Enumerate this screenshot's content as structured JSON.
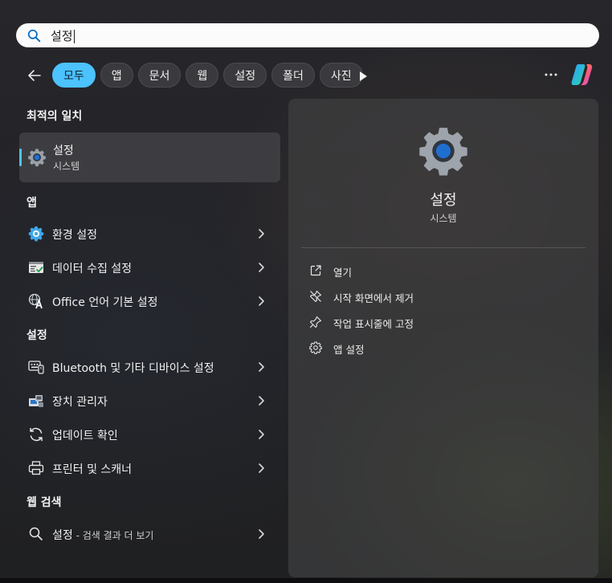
{
  "search": {
    "query": "설정"
  },
  "filters": {
    "chips": [
      "모두",
      "앱",
      "문서",
      "웹",
      "설정",
      "폴더",
      "사진"
    ],
    "active_index": 0
  },
  "best_match": {
    "title": "최적의 일치",
    "name": "설정",
    "type": "시스템"
  },
  "apps": {
    "title": "앱",
    "items": [
      {
        "label": "환경 설정",
        "icon": "control-panel-icon"
      },
      {
        "label": "데이터 수집 설정",
        "icon": "data-collection-icon"
      },
      {
        "label": "Office 언어 기본 설정",
        "icon": "language-icon"
      }
    ]
  },
  "settings": {
    "title": "설정",
    "items": [
      {
        "label": "Bluetooth 및 기타 디바이스 설정",
        "icon": "bluetooth-devices-icon"
      },
      {
        "label": "장치 관리자",
        "icon": "device-manager-icon"
      },
      {
        "label": "업데이트 확인",
        "icon": "sync-icon"
      },
      {
        "label": "프린터 및 스캐너",
        "icon": "printer-icon"
      }
    ]
  },
  "web": {
    "title": "웹 검색",
    "item": {
      "label": "설정",
      "suffix": " - 검색 결과 더 보기"
    }
  },
  "detail": {
    "name": "설정",
    "type": "시스템",
    "actions": [
      {
        "label": "열기",
        "icon": "open-external-icon"
      },
      {
        "label": "시작 화면에서 제거",
        "icon": "unpin-icon"
      },
      {
        "label": "작업 표시줄에 고정",
        "icon": "pin-icon"
      },
      {
        "label": "앱 설정",
        "icon": "gear-icon"
      }
    ]
  },
  "colors": {
    "accent": "#4cc2ff",
    "panel": "#3e3e40",
    "background": "#1c1c1e"
  }
}
